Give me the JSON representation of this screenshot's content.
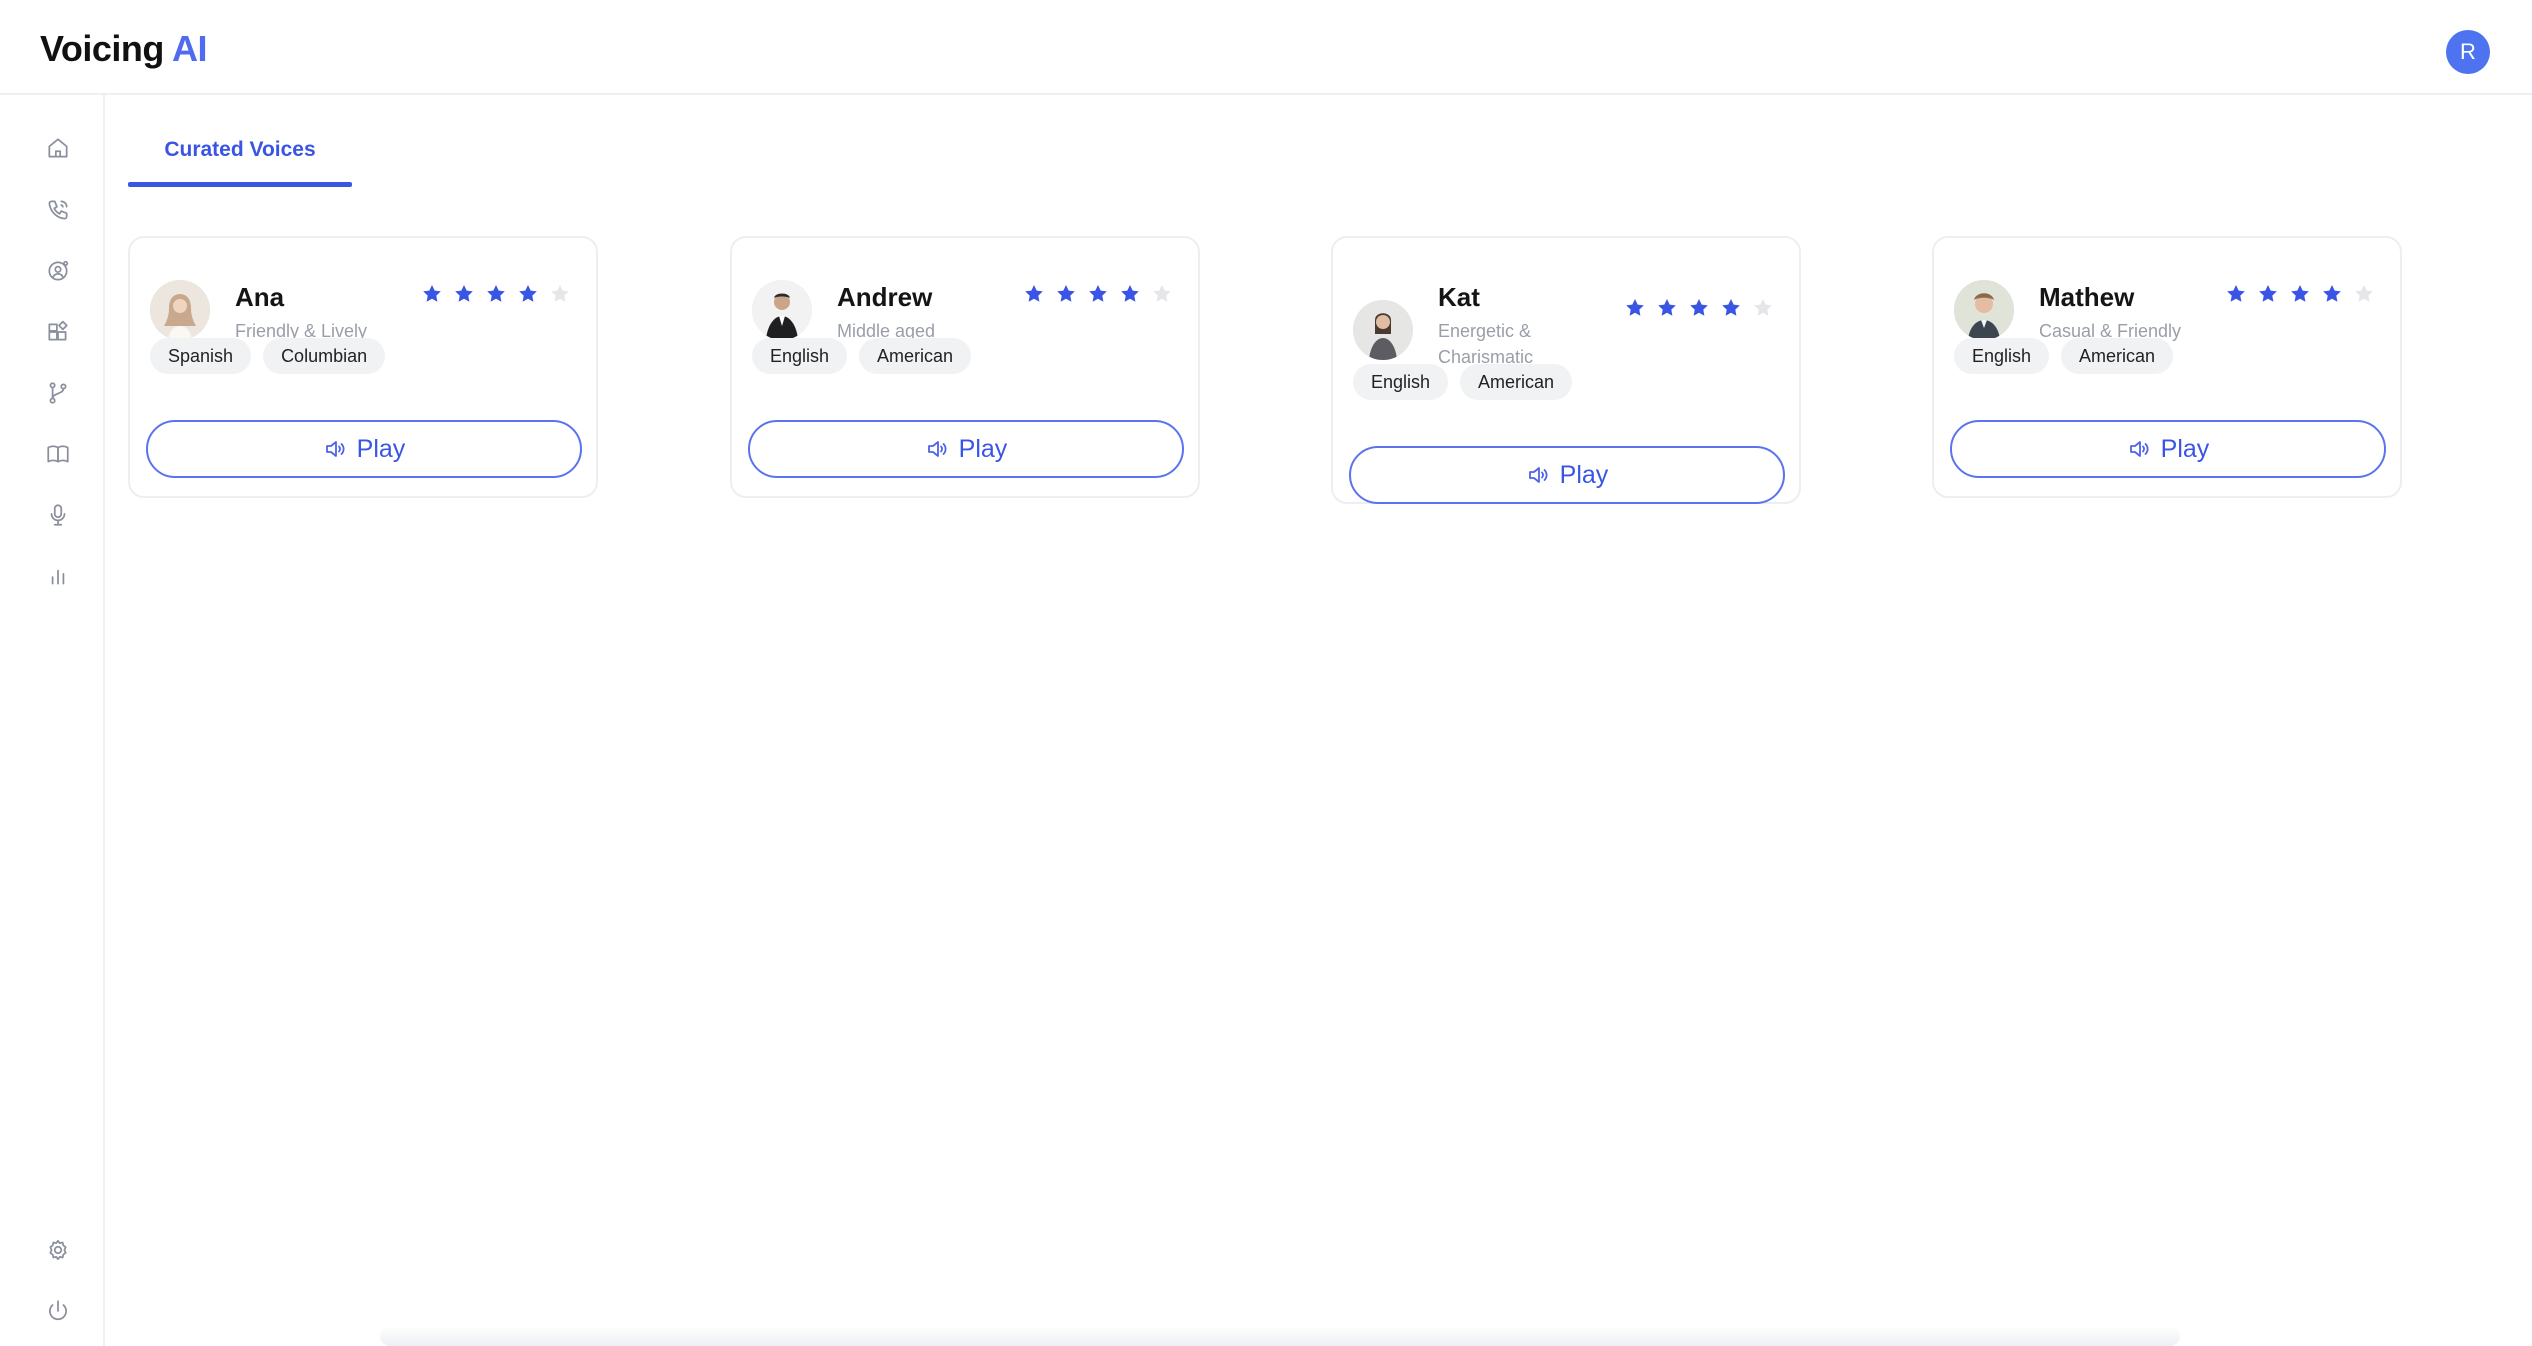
{
  "header": {
    "logo_main": "Voicing",
    "logo_accent": "AI",
    "user_initial": "R"
  },
  "sidebar": {
    "items": [
      {
        "icon": "home-icon"
      },
      {
        "icon": "phone-call-icon"
      },
      {
        "icon": "agent-settings-icon"
      },
      {
        "icon": "integrations-icon"
      },
      {
        "icon": "workflow-branch-icon"
      },
      {
        "icon": "book-icon"
      },
      {
        "icon": "microphone-icon"
      },
      {
        "icon": "analytics-chart-icon"
      }
    ],
    "bottom_items": [
      {
        "icon": "gear-icon"
      },
      {
        "icon": "power-icon"
      }
    ]
  },
  "tabs": [
    {
      "label": "Curated Voices",
      "active": true
    }
  ],
  "voices": [
    {
      "name": "Ana",
      "description": "Friendly & Lively",
      "rating": 4,
      "max_rating": 5,
      "tags": [
        "Spanish",
        "Columbian"
      ],
      "play_label": "Play"
    },
    {
      "name": "Andrew",
      "description": "Middle aged",
      "rating": 4,
      "max_rating": 5,
      "tags": [
        "English",
        "American"
      ],
      "play_label": "Play"
    },
    {
      "name": "Kat",
      "description": "Energetic & Charismatic",
      "rating": 4,
      "max_rating": 5,
      "tags": [
        "English",
        "American"
      ],
      "play_label": "Play"
    },
    {
      "name": "Mathew",
      "description": "Casual & Friendly",
      "rating": 4,
      "max_rating": 5,
      "tags": [
        "English",
        "American"
      ],
      "play_label": "Play"
    }
  ],
  "colors": {
    "accent": "#3a55e4",
    "star_filled": "#3a55e4",
    "star_empty": "#e4e6ea",
    "avatar_bg": "#4d73f0"
  }
}
